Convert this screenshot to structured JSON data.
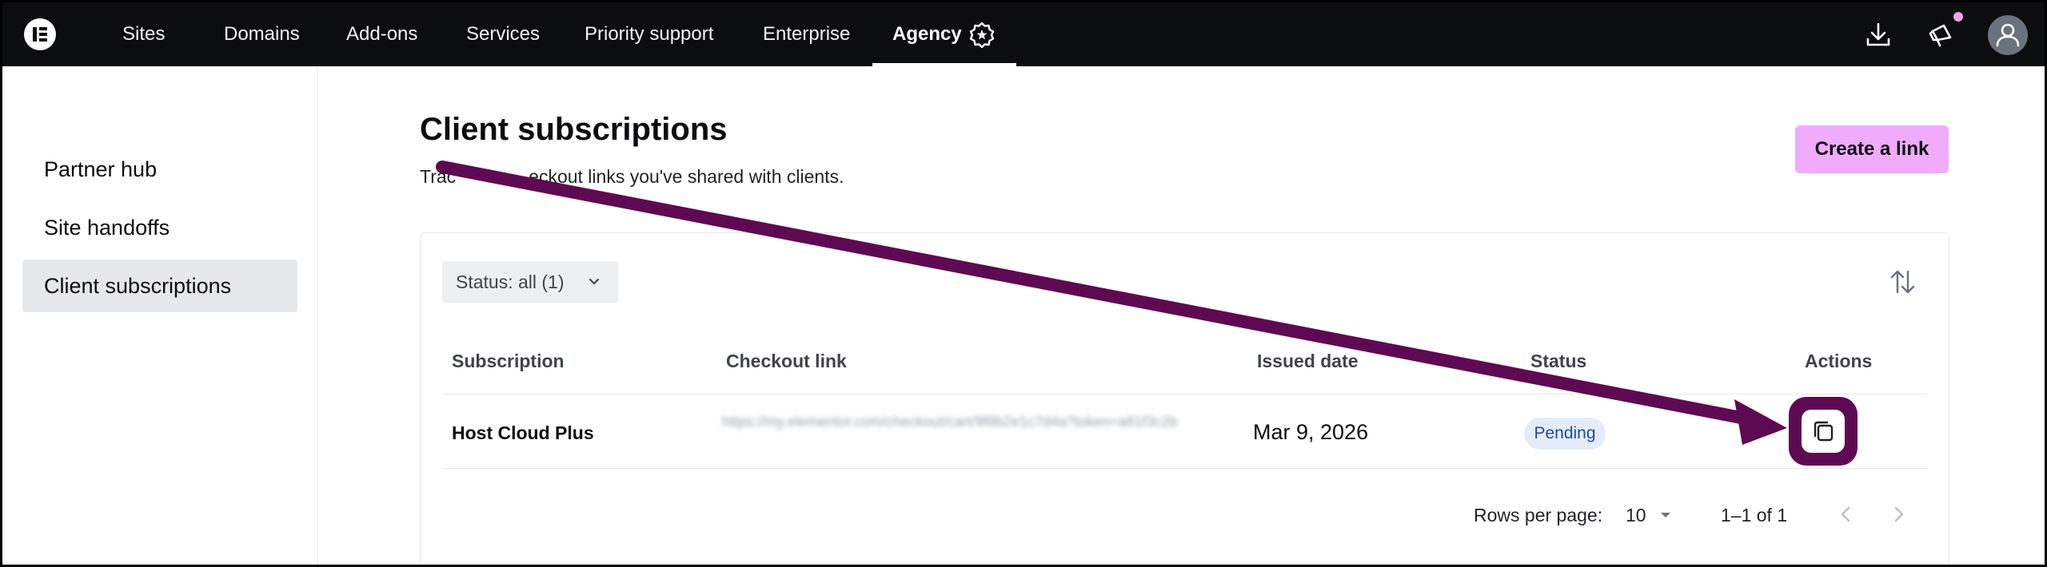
{
  "topbar": {
    "logo": "elementor-logo-icon",
    "nav": [
      {
        "label": "Sites"
      },
      {
        "label": "Domains"
      },
      {
        "label": "Add-ons"
      },
      {
        "label": "Services"
      },
      {
        "label": "Priority support"
      },
      {
        "label": "Enterprise"
      },
      {
        "label": "Agency",
        "active": true,
        "icon": "agency-badge-icon"
      }
    ],
    "right_icons": [
      "download-icon",
      "megaphone-icon",
      "user-avatar-icon"
    ]
  },
  "sidebar": {
    "items": [
      {
        "label": "Partner hub"
      },
      {
        "label": "Site handoffs"
      },
      {
        "label": "Client subscriptions",
        "active": true
      }
    ]
  },
  "main": {
    "title": "Client subscriptions",
    "subtitle_start": "Trac",
    "subtitle_end": "eckout links you've shared with clients.",
    "create_button": "Create a link",
    "filter": {
      "label": "Status: all (1)",
      "icon": "chevron-down-icon"
    },
    "sort_icon": "sort-arrows-icon",
    "table": {
      "columns": [
        "Subscription",
        "Checkout link",
        "Issued date",
        "Status",
        "Actions"
      ],
      "rows": [
        {
          "subscription": "Host Cloud Plus",
          "checkout_link": "https://my.elementor.com/checkout/cart/9f8b2e1c7d4a?token=a81f3c2b",
          "issued_date": "Mar 9, 2026",
          "status": "Pending",
          "action_icon": "copy-icon"
        }
      ]
    },
    "pagination": {
      "rows_per_page_label": "Rows per page:",
      "rows_per_page_value": "10",
      "range": "1–1 of 1"
    }
  },
  "colors": {
    "topbar_bg": "#0c0d0e",
    "accent_pink": "#f0abfc",
    "pending_bg": "#e4ecf9",
    "annotation_arrow": "#5e0a52"
  }
}
